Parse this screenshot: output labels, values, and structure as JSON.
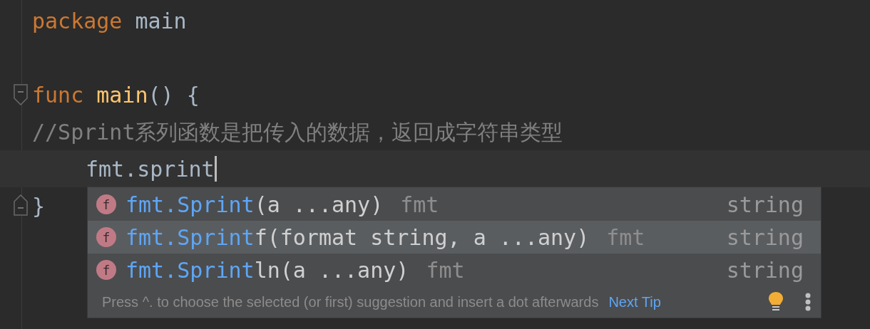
{
  "editor": {
    "lines": [
      {
        "kind": "code",
        "tokens": [
          {
            "kind": "keyword",
            "text": "package"
          },
          {
            "kind": "plain",
            "text": "main"
          }
        ]
      },
      {
        "kind": "code"
      },
      {
        "kind": "opener",
        "tokens": [
          {
            "kind": "keyword",
            "text": "func"
          },
          {
            "kind": "function",
            "text": "main"
          },
          {
            "kind": "punct",
            "text": "() {"
          }
        ]
      },
      {
        "kind": "code",
        "tokens": [
          {
            "kind": "comment",
            "text": "//Sprint系列函数是把传入的数据，返回成字符串类型"
          }
        ]
      },
      {
        "kind": "code",
        "indented": true,
        "current": true,
        "tokens": [
          {
            "kind": "plain",
            "text": "fmt.sprint"
          }
        ]
      },
      {
        "kind": "closer",
        "tokens": [
          {
            "kind": "punct",
            "text": "}"
          }
        ]
      }
    ]
  },
  "completion": {
    "items": [
      {
        "icon": "f",
        "match": "fmt.Sprint",
        "rest": "(a ...any)",
        "package": "fmt",
        "type": "string",
        "selected": false
      },
      {
        "icon": "f",
        "match": "fmt.Sprint",
        "rest": "f(format string, a ...any)",
        "package": "fmt",
        "type": "string",
        "selected": true
      },
      {
        "icon": "f",
        "match": "fmt.Sprint",
        "rest": "ln(a ...any)",
        "package": "fmt",
        "type": "string",
        "selected": false
      }
    ],
    "hint": "Press ^. to choose the selected (or first) suggestion and insert a dot afterwards",
    "next_tip": "Next Tip"
  }
}
